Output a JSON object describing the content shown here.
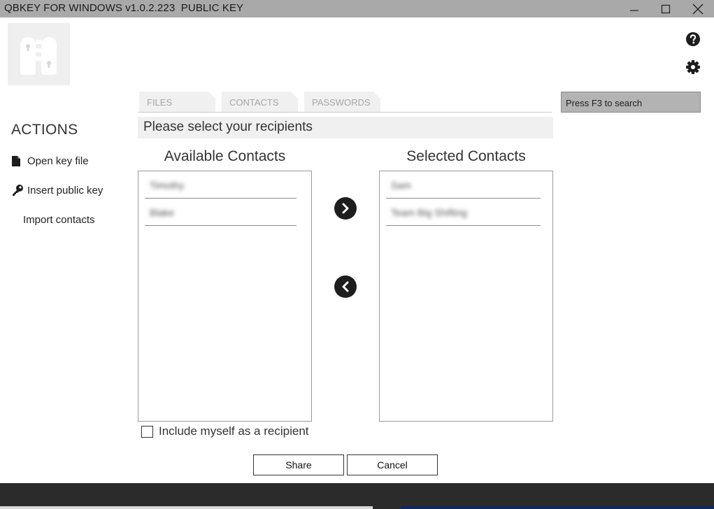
{
  "window": {
    "title": "QBKEY FOR WINDOWS v1.0.2.223  PUBLIC KEY"
  },
  "actions": {
    "title": "ACTIONS",
    "items": [
      {
        "label": "Open key file",
        "icon": "file-icon"
      },
      {
        "label": "Insert public key",
        "icon": "key-icon"
      },
      {
        "label": "Import contacts",
        "icon": ""
      }
    ]
  },
  "tabs": [
    {
      "label": "FILES"
    },
    {
      "label": "CONTACTS"
    },
    {
      "label": "PASSWORDS"
    }
  ],
  "search": {
    "placeholder": "Press F3 to search"
  },
  "instruction": "Please select your recipients",
  "available": {
    "title": "Available Contacts",
    "items": [
      "Timothy",
      "Blake"
    ]
  },
  "selected": {
    "title": "Selected Contacts",
    "items": [
      "Sam",
      "Team Big Shifting"
    ]
  },
  "include_myself": {
    "label": "Include myself as a recipient",
    "checked": false
  },
  "buttons": {
    "share": "Share",
    "cancel": "Cancel"
  },
  "colors": {
    "titlebar": "#a9a9a9",
    "tab_bg": "#f0f0f0",
    "tab_text": "#a6a6a6",
    "search_bg": "#b3b3b3",
    "arrow_bg": "#1d1d1d",
    "taskbar": "#2b2b2b"
  }
}
